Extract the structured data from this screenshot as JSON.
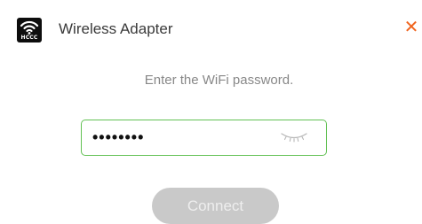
{
  "window": {
    "title": "Wireless Adapter",
    "app_icon": "wifi-adapter-icon",
    "app_icon_brand": "HCCC",
    "close_icon": "close-icon",
    "close_glyph": "✕"
  },
  "form": {
    "prompt": "Enter the WiFi password.",
    "password_masked": "••••••••",
    "toggle_icon": "eye-closed-icon",
    "connect_label": "Connect"
  },
  "colors": {
    "close": "#f0641e",
    "field_border": "#62c154",
    "button_disabled": "#c9c9c9"
  }
}
